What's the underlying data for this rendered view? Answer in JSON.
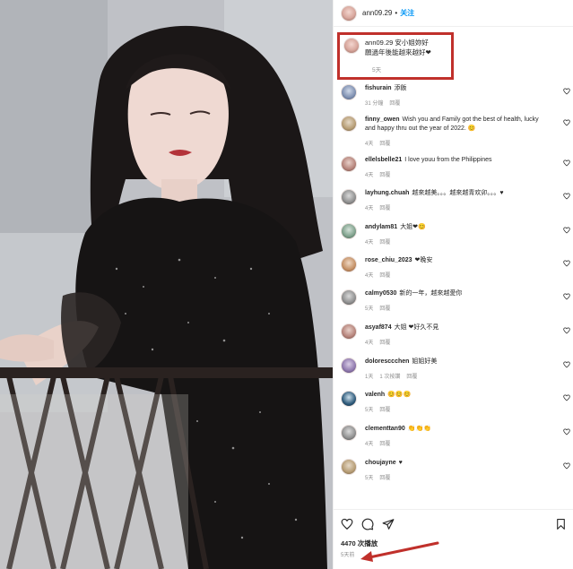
{
  "header": {
    "username": "ann09.29",
    "dot": "•",
    "follow_label": "关注"
  },
  "caption": {
    "text_line1": "ann09.29 安小姐妳好",
    "text_line2": "願過年後能越來越好❤",
    "time": "5天"
  },
  "comments": [
    {
      "user": "fishurain",
      "text": "添飯",
      "time": "31 分鐘",
      "reply": "回覆"
    },
    {
      "user": "finny_owen",
      "text": "Wish you and Family got the best of health, lucky and happy thru out the year of 2022. 😊",
      "time": "4天",
      "reply": "回覆"
    },
    {
      "user": "ellelsbelle21",
      "text": "I love youu from the Philippines",
      "time": "4天",
      "reply": "回覆"
    },
    {
      "user": "layhung.chuah",
      "text": "越來越美。。。越來越青欢卯。。。♥",
      "time": "4天",
      "reply": "回覆"
    },
    {
      "user": "andylam81",
      "text": "大姐❤😊",
      "time": "4天",
      "reply": "回覆"
    },
    {
      "user": "rose_chiu_2023",
      "text": "❤晚安",
      "time": "4天",
      "reply": "回覆"
    },
    {
      "user": "calmy0530",
      "text": "新的一年，越來越愛你",
      "time": "5天",
      "reply": "回覆"
    },
    {
      "user": "asyaf874",
      "text": "大姐 ❤好久不見",
      "time": "4天",
      "reply": "回覆"
    },
    {
      "user": "doloresccchen",
      "text": "姐姐好美",
      "time": "1天",
      "likes": "1 次按讚",
      "reply": "回覆"
    },
    {
      "user": "valenh",
      "text": "😊😊😊",
      "time": "5天",
      "reply": "回覆"
    },
    {
      "user": "clementtan90",
      "text": "👏👏👏",
      "time": "4天",
      "reply": "回覆"
    },
    {
      "user": "choujayne",
      "text": "♥",
      "time": "5天",
      "reply": "回覆"
    }
  ],
  "footer": {
    "views": "4470 次播放",
    "ago": "5天前"
  },
  "icons": {
    "like": "heart-icon",
    "comment": "comment-icon",
    "share": "send-icon",
    "save": "bookmark-icon"
  },
  "colors": {
    "accent": "#0095f6",
    "highlight": "#c0302b"
  }
}
